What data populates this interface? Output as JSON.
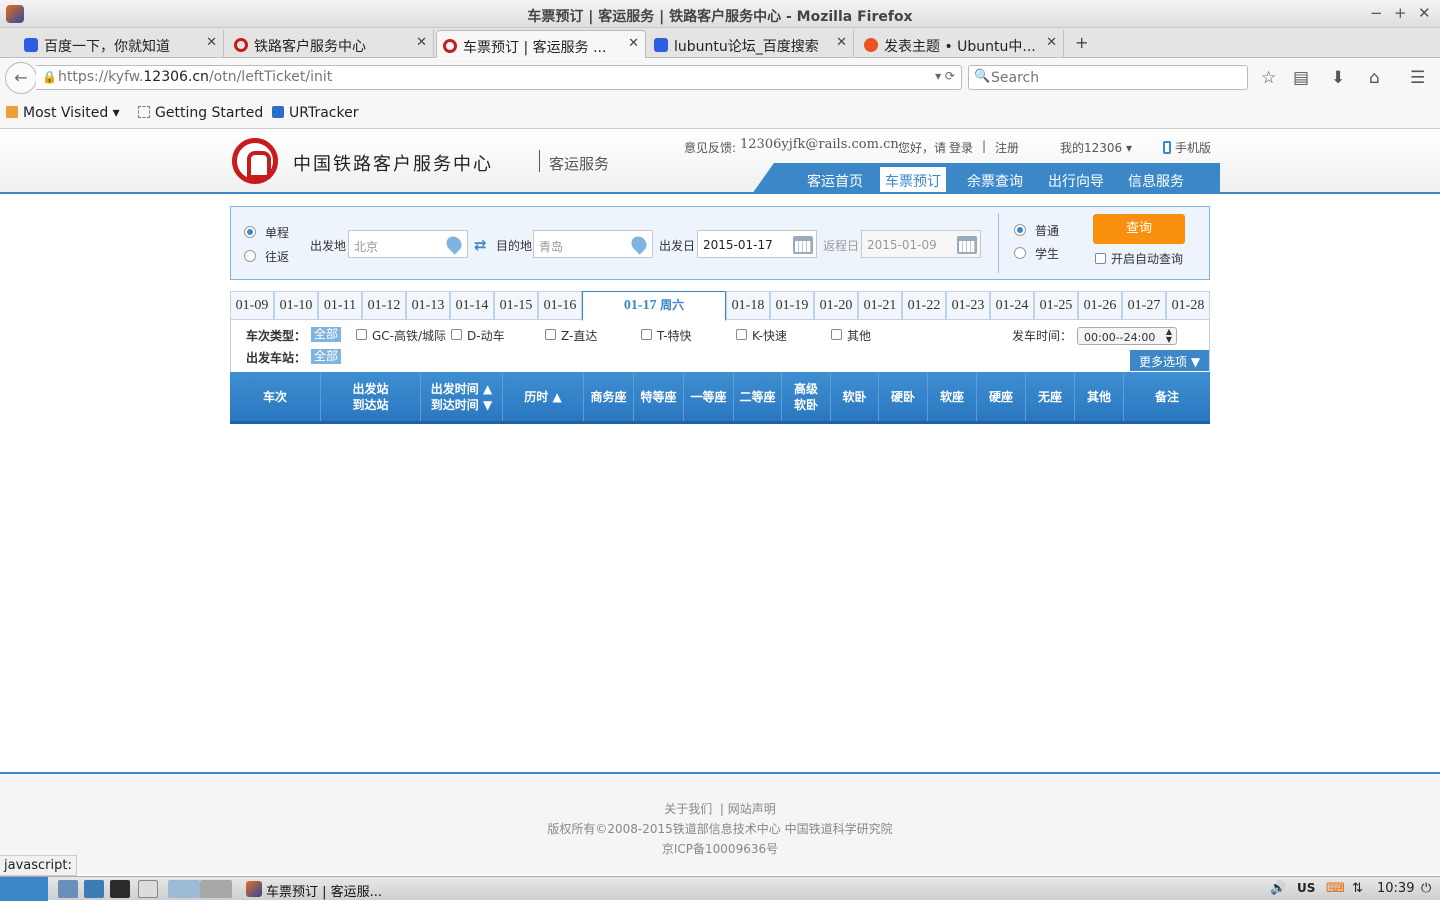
{
  "window": {
    "title": "车票预订 | 客运服务 | 铁路客户服务中心 - Mozilla Firefox",
    "controls": [
      "−",
      "+",
      "✕"
    ]
  },
  "tabs": [
    {
      "label": "百度一下，你就知道",
      "icon": "baidu-paw-icon",
      "color": "#2f5de1"
    },
    {
      "label": "铁路客户服务中心",
      "icon": "railway-logo-icon",
      "color": "#c81b1b"
    },
    {
      "label": "车票预订 | 客运服务 ...",
      "icon": "railway-logo-icon",
      "color": "#c81b1b",
      "active": true
    },
    {
      "label": "lubuntu论坛_百度搜索",
      "icon": "baidu-paw-icon",
      "color": "#2f5de1"
    },
    {
      "label": "发表主题 • Ubuntu中...",
      "icon": "ubuntu-icon",
      "color": "#e95420"
    }
  ],
  "navbar": {
    "url_prefix": "https://kyfw.",
    "url_domain": "12306.cn",
    "url_path": "/otn/leftTicket/init",
    "search_placeholder": "Search"
  },
  "bookmarks": [
    {
      "label": "Most Visited ▾",
      "icon": "most-visited-icon"
    },
    {
      "label": "Getting Started",
      "icon": "page-icon"
    },
    {
      "label": "URTracker",
      "icon": "urtracker-icon"
    }
  ],
  "site": {
    "brand": "中国铁路客户服务中心",
    "brand_sub": "客运服务",
    "feedback_label": "意见反馈:",
    "feedback_email": "12306yjfk@rails.com.cn",
    "greeting": "您好，请",
    "login": "登录",
    "sep": "|",
    "register": "注册",
    "my12306": "我的12306",
    "mobile": "手机版",
    "nav": [
      "客运首页",
      "车票预订",
      "余票查询",
      "出行向导",
      "信息服务"
    ],
    "nav_active": "车票预订"
  },
  "query": {
    "trip_oneway": "单程",
    "trip_round": "往返",
    "from_label": "出发地",
    "from_value": "北京",
    "to_label": "目的地",
    "to_value": "青岛",
    "depart_label": "出发日",
    "depart_value": "2015-01-17",
    "return_label": "返程日",
    "return_value": "2015-01-09",
    "type_normal": "普通",
    "type_student": "学生",
    "search_btn": "查询",
    "auto_query": "开启自动查询"
  },
  "dates_before": [
    "01-09",
    "01-10",
    "01-11",
    "01-12",
    "01-13",
    "01-14",
    "01-15",
    "01-16"
  ],
  "date_active": "01-17",
  "date_active_weekday": "周六",
  "dates_after": [
    "01-18",
    "01-19",
    "01-20",
    "01-21",
    "01-22",
    "01-23",
    "01-24",
    "01-25",
    "01-26",
    "01-27",
    "01-28"
  ],
  "filters": {
    "train_type_label": "车次类型：",
    "all": "全部",
    "types": [
      "GC-高铁/城际",
      "D-动车",
      "Z-直达",
      "T-特快",
      "K-快速",
      "其他"
    ],
    "station_label": "出发车站：",
    "depart_time_label": "发车时间：",
    "depart_time_value": "00:00--24:00",
    "more": "更多选项"
  },
  "table_headers": [
    {
      "l1": "车次",
      "l2": ""
    },
    {
      "l1": "出发站",
      "l2": "到达站"
    },
    {
      "l1": "出发时间 ▲",
      "l2": "到达时间 ▼"
    },
    {
      "l1": "历时 ▲",
      "l2": ""
    },
    {
      "l1": "商务座",
      "l2": ""
    },
    {
      "l1": "特等座",
      "l2": ""
    },
    {
      "l1": "一等座",
      "l2": ""
    },
    {
      "l1": "二等座",
      "l2": ""
    },
    {
      "l1": "高级",
      "l2": "软卧"
    },
    {
      "l1": "软卧",
      "l2": ""
    },
    {
      "l1": "硬卧",
      "l2": ""
    },
    {
      "l1": "软座",
      "l2": ""
    },
    {
      "l1": "硬座",
      "l2": ""
    },
    {
      "l1": "无座",
      "l2": ""
    },
    {
      "l1": "其他",
      "l2": ""
    },
    {
      "l1": "备注",
      "l2": ""
    }
  ],
  "footer": {
    "about": "关于我们",
    "notice": "网站声明",
    "copyright": "版权所有©2008-2015铁道部信息技术中心   中国铁道科学研究院",
    "icp": "京ICP备10009636号"
  },
  "status_text": "javascript:",
  "taskbar": {
    "app": "车票预订 | 客运服...",
    "kbd": "US",
    "clock": "10:39"
  },
  "colors": {
    "accent": "#3b87c8",
    "orange": "#f8900e",
    "brand_red": "#c81b1b"
  }
}
